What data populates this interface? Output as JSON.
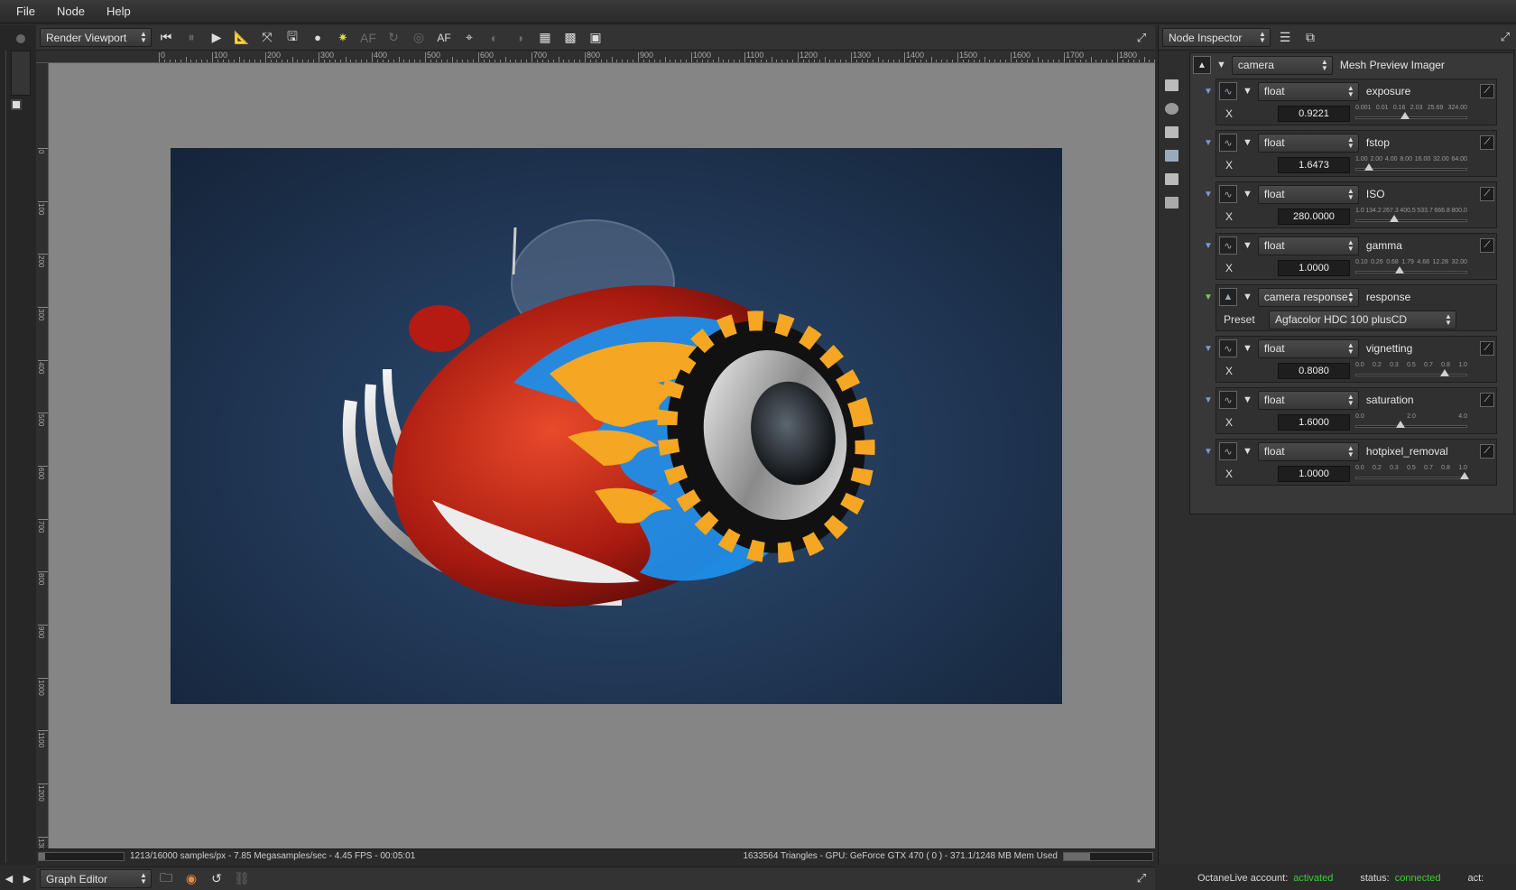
{
  "menu": [
    "File",
    "Node",
    "Help"
  ],
  "viewport": {
    "combo": "Render Viewport",
    "af_label": "AF",
    "ruler_h": [
      "0",
      "100",
      "200",
      "300",
      "400",
      "500",
      "600",
      "700",
      "800",
      "900",
      "1000",
      "1100",
      "1200",
      "1300",
      "1400",
      "1500",
      "1600",
      "1700",
      "1800"
    ],
    "ruler_v": [
      "0",
      "100",
      "200",
      "300",
      "400",
      "500",
      "600",
      "700",
      "800",
      "900",
      "1000",
      "1100",
      "1200",
      "1300"
    ],
    "status_left": "1213/16000 samples/px - 7.85 Megasamples/sec - 4.45 FPS - 00:05:01",
    "status_right": "1633564 Triangles - GPU: GeForce GTX 470 ( 0 ) - 371.1/1248 MB Mem Used",
    "sample_progress": 0.076,
    "mem_progress": 0.3
  },
  "graph_editor": {
    "combo": "Graph Editor"
  },
  "inspector": {
    "combo": "Node Inspector",
    "root_type": "camera",
    "root_name": "Mesh Preview Imager",
    "params": [
      {
        "type": "float",
        "name": "exposure",
        "axis": "X",
        "value": "0.9221",
        "ticks": "0.001 0.01 0.16 2.03 25.69 324.00",
        "pos": 0.44
      },
      {
        "type": "float",
        "name": "fstop",
        "axis": "X",
        "value": "1.6473",
        "ticks": "1.00 2.00 4.00 8.00 16.00 32.00 64.00",
        "pos": 0.1
      },
      {
        "type": "float",
        "name": "ISO",
        "axis": "X",
        "value": "280.0000",
        "ticks": "1.0 134.2 267.3 400.5 533.7 666.8 800.0",
        "pos": 0.34
      },
      {
        "type": "float",
        "name": "gamma",
        "axis": "X",
        "value": "1.0000",
        "ticks": "0.10 0.26 0.68 1.79 4.68 12.28 32.00",
        "pos": 0.39
      },
      {
        "type": "camera response",
        "name": "response",
        "axis": "Preset",
        "value": "Agfacolor HDC 100 plusCD"
      },
      {
        "type": "float",
        "name": "vignetting",
        "axis": "X",
        "value": "0.8080",
        "ticks": "0.0 0.2 0.3 0.5 0.7 0.8 1.0",
        "pos": 0.81
      },
      {
        "type": "float",
        "name": "saturation",
        "axis": "X",
        "value": "1.6000",
        "ticks": "0.0 2.0 4.0",
        "pos": 0.4
      },
      {
        "type": "float",
        "name": "hotpixel_removal",
        "axis": "X",
        "value": "1.0000",
        "ticks": "0.0 0.2 0.3 0.5 0.7 0.8 1.0",
        "pos": 1.0
      }
    ]
  },
  "footer": {
    "account_label": "OctaneLive account:",
    "account_value": "activated",
    "status_label": "status:",
    "status_value": "connected",
    "act_label": "act:"
  },
  "colors": {
    "accent_green": "#39d12f",
    "render_bg": "#1f3656",
    "canvas_bg": "#858585"
  }
}
